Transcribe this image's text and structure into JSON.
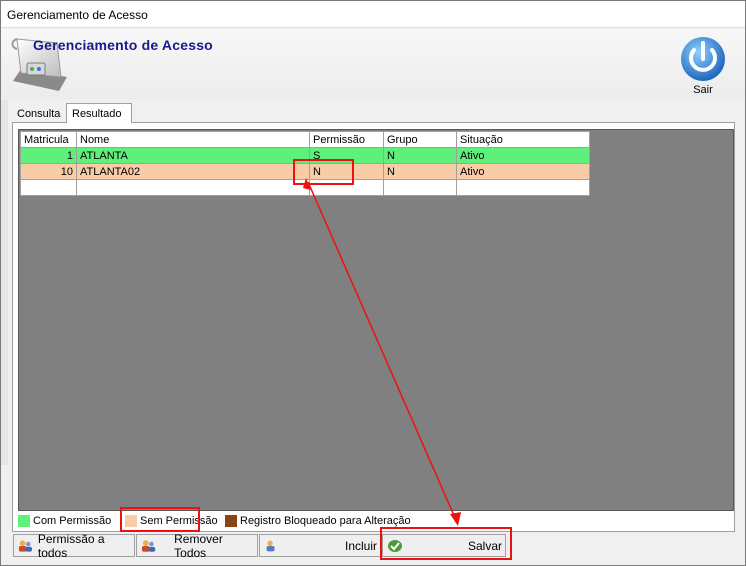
{
  "window": {
    "title": "Gerenciamento de Acesso"
  },
  "header": {
    "title": "Gerenciamento de Acesso",
    "exit_label": "Sair"
  },
  "tabs": [
    {
      "label": "Consulta"
    },
    {
      "label": "Resultado"
    }
  ],
  "grid": {
    "columns": [
      "Matricula",
      "Nome",
      "Permissão",
      "Grupo",
      "Situação"
    ],
    "rows": [
      {
        "matricula": "1",
        "nome": "ATLANTA",
        "permissao": "S",
        "grupo": "N",
        "situacao": "Ativo",
        "status": "com_permissao"
      },
      {
        "matricula": "10",
        "nome": "ATLANTA02",
        "permissao": "N",
        "grupo": "N",
        "situacao": "Ativo",
        "status": "sem_permissao"
      }
    ]
  },
  "legend": [
    {
      "label": "Com Permissão",
      "color": "#5ef07a"
    },
    {
      "label": "Sem Permissão",
      "color": "#f8cca6"
    },
    {
      "label": "Registro Bloqueado para Alteração",
      "color": "#8b4513"
    }
  ],
  "buttons": {
    "permissao_todos": "Permissão a todos",
    "remover_todos": "Remover Todos",
    "incluir": "Incluir",
    "salvar": "Salvar"
  },
  "colors": {
    "accent": "#1a1a8a",
    "annotation": "#ee1111",
    "grid_background": "#808080"
  }
}
